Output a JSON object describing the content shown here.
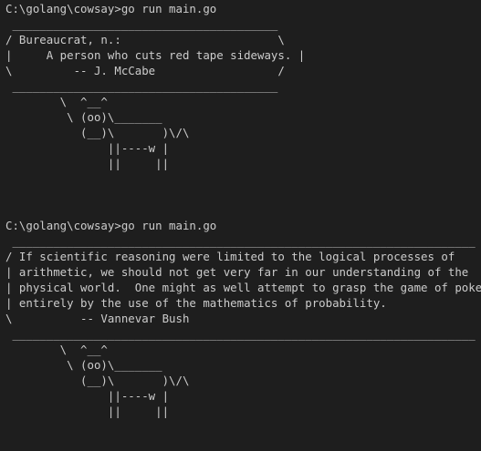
{
  "sessions": [
    {
      "prompt": "C:\\golang\\cowsay>",
      "command": "go run main.go",
      "output": [
        " _______________________________________",
        "/ Bureaucrat, n.:                       \\",
        "|     A person who cuts red tape sideways. |",
        "\\         -- J. McCabe                  /",
        " _______________________________________",
        "        \\  ^__^",
        "         \\ (oo)\\_______",
        "           (__)\\       )\\/\\",
        "               ||----w |",
        "               ||     ||"
      ]
    },
    {
      "prompt": "C:\\golang\\cowsay>",
      "command": "go run main.go",
      "output": [
        " ____________________________________________________________________",
        "/ If scientific reasoning were limited to the logical processes of     \\",
        "| arithmetic, we should not get very far in our understanding of the   |",
        "| physical world.  One might as well attempt to grasp the game of poker |",
        "| entirely by the use of the mathematics of probability.                |",
        "\\          -- Vannevar Bush                                           /",
        " ____________________________________________________________________",
        "        \\  ^__^",
        "         \\ (oo)\\_______",
        "           (__)\\       )\\/\\",
        "               ||----w |",
        "               ||     ||"
      ]
    }
  ]
}
